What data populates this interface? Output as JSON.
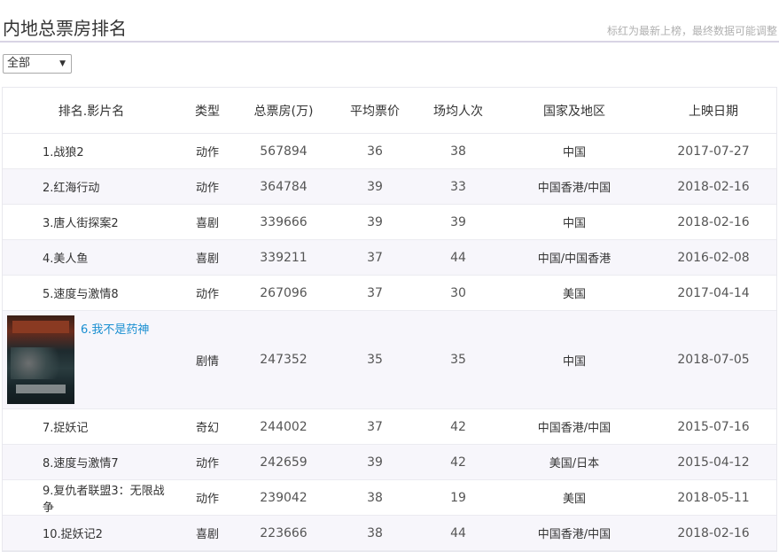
{
  "page": {
    "title": "内地总票房排名",
    "note": "标红为最新上榜，最终数据可能调整"
  },
  "filter": {
    "selected": "全部"
  },
  "columns": [
    "排名.影片名",
    "类型",
    "总票房(万)",
    "平均票价",
    "场均人次",
    "国家及地区",
    "上映日期"
  ],
  "rows": [
    {
      "name": "1.战狼2",
      "genre": "动作",
      "box": "567894",
      "price": "36",
      "people": "38",
      "region": "中国",
      "date": "2017-07-27"
    },
    {
      "name": "2.红海行动",
      "genre": "动作",
      "box": "364784",
      "price": "39",
      "people": "33",
      "region": "中国香港/中国",
      "date": "2018-02-16"
    },
    {
      "name": "3.唐人街探案2",
      "genre": "喜剧",
      "box": "339666",
      "price": "39",
      "people": "39",
      "region": "中国",
      "date": "2018-02-16"
    },
    {
      "name": "4.美人鱼",
      "genre": "喜剧",
      "box": "339211",
      "price": "37",
      "people": "44",
      "region": "中国/中国香港",
      "date": "2016-02-08"
    },
    {
      "name": "5.速度与激情8",
      "genre": "动作",
      "box": "267096",
      "price": "37",
      "people": "30",
      "region": "美国",
      "date": "2017-04-14"
    },
    {
      "name": "6.我不是药神",
      "genre": "剧情",
      "box": "247352",
      "price": "35",
      "people": "35",
      "region": "中国",
      "date": "2018-07-05",
      "poster_icon": "movie-poster"
    },
    {
      "name": "7.捉妖记",
      "genre": "奇幻",
      "box": "244002",
      "price": "37",
      "people": "42",
      "region": "中国香港/中国",
      "date": "2015-07-16"
    },
    {
      "name": "8.速度与激情7",
      "genre": "动作",
      "box": "242659",
      "price": "39",
      "people": "42",
      "region": "美国/日本",
      "date": "2015-04-12"
    },
    {
      "name": "9.复仇者联盟3：无限战争",
      "genre": "动作",
      "box": "239042",
      "price": "38",
      "people": "19",
      "region": "美国",
      "date": "2018-05-11"
    },
    {
      "name": "10.捉妖记2",
      "genre": "喜剧",
      "box": "223666",
      "price": "38",
      "people": "44",
      "region": "中国香港/中国",
      "date": "2018-02-16"
    }
  ],
  "colors": {
    "link": "#1a8fd1",
    "header_line": "#d8d4e4",
    "alt_row": "#f7f6fb"
  }
}
